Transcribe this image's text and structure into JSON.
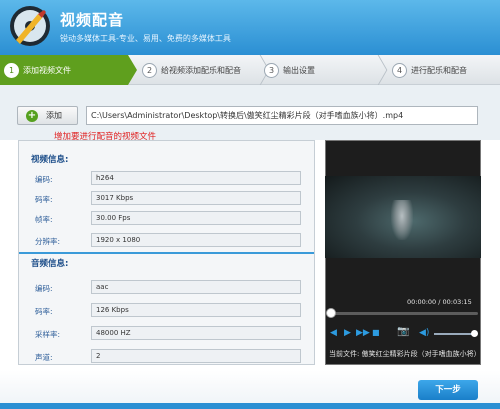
{
  "app": {
    "title": "视频配音",
    "subtitle": "锐动多媒体工具-专业、易用、免费的多媒体工具"
  },
  "steps": [
    {
      "num": "1",
      "label": "添加视频文件",
      "active": true
    },
    {
      "num": "2",
      "label": "给视频添加配乐和配音",
      "active": false
    },
    {
      "num": "3",
      "label": "输出设置",
      "active": false
    },
    {
      "num": "4",
      "label": "进行配乐和配音",
      "active": false
    }
  ],
  "toolbar": {
    "add_label": "添加",
    "file_path": "C:\\Users\\Administrator\\Desktop\\转换后\\傲笑红尘精彩片段（对手嗜血族小将）.mp4",
    "hint": "增加要进行配音的视频文件"
  },
  "video_info": {
    "title": "视频信息:",
    "rows": [
      {
        "label": "编码:",
        "value": "h264"
      },
      {
        "label": "码率:",
        "value": "3017 Kbps"
      },
      {
        "label": "帧率:",
        "value": "30.00 Fps"
      },
      {
        "label": "分辨率:",
        "value": "1920 x 1080"
      }
    ]
  },
  "audio_info": {
    "title": "音频信息:",
    "rows": [
      {
        "label": "编码:",
        "value": "aac"
      },
      {
        "label": "码率:",
        "value": "126 Kbps"
      },
      {
        "label": "采样率:",
        "value": "48000 HZ"
      },
      {
        "label": "声道:",
        "value": "2"
      }
    ]
  },
  "player": {
    "time": "00:00:00 / 00:03:15",
    "current_file": "当前文件: 傲笑红尘精彩片段（对手嗜血族小将）.mp4",
    "progress": 0,
    "volume": 0.92
  },
  "footer": {
    "next_label": "下一步"
  },
  "colors": {
    "header": "#2b8fd3",
    "active_step": "#5f9f1e",
    "hint": "#e02020",
    "label": "#2f5f9a"
  }
}
